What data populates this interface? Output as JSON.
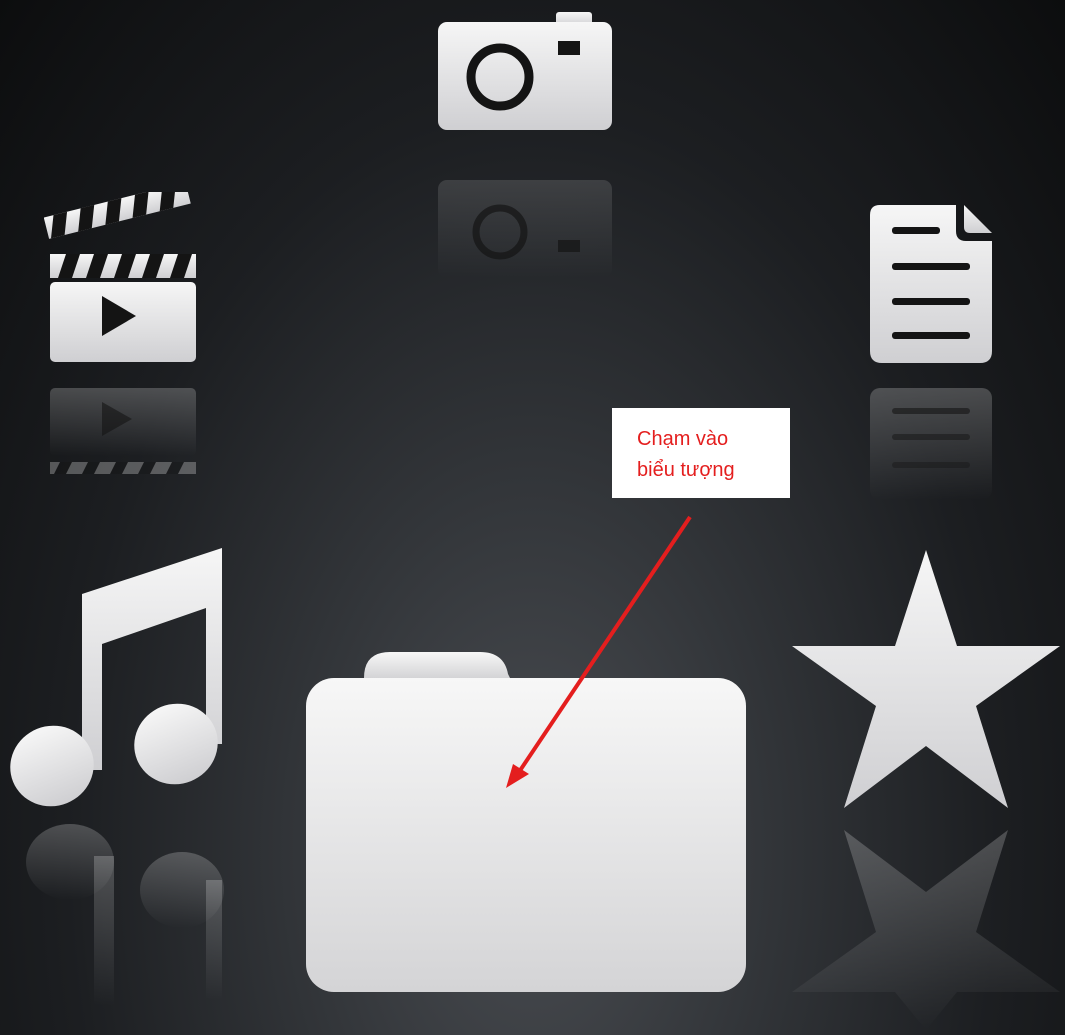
{
  "callout": {
    "lines": [
      "Chạm vào",
      "biểu tượng"
    ],
    "text_color": "#e41e1e",
    "background": "#ffffff",
    "arrow_color": "#e41e1e"
  },
  "icons": [
    {
      "name": "camera-icon",
      "role": "Photos"
    },
    {
      "name": "video-clapperboard-icon",
      "role": "Videos"
    },
    {
      "name": "document-icon",
      "role": "Documents"
    },
    {
      "name": "music-note-icon",
      "role": "Music"
    },
    {
      "name": "folder-icon",
      "role": "Files",
      "selected": true
    },
    {
      "name": "star-icon",
      "role": "Favorites"
    }
  ],
  "colors": {
    "icon_fill_light": "#f4f4f4",
    "icon_fill_dark": "#c9c9cc",
    "background_center": "#4a4d52",
    "background_edge": "#0c0d0e"
  }
}
